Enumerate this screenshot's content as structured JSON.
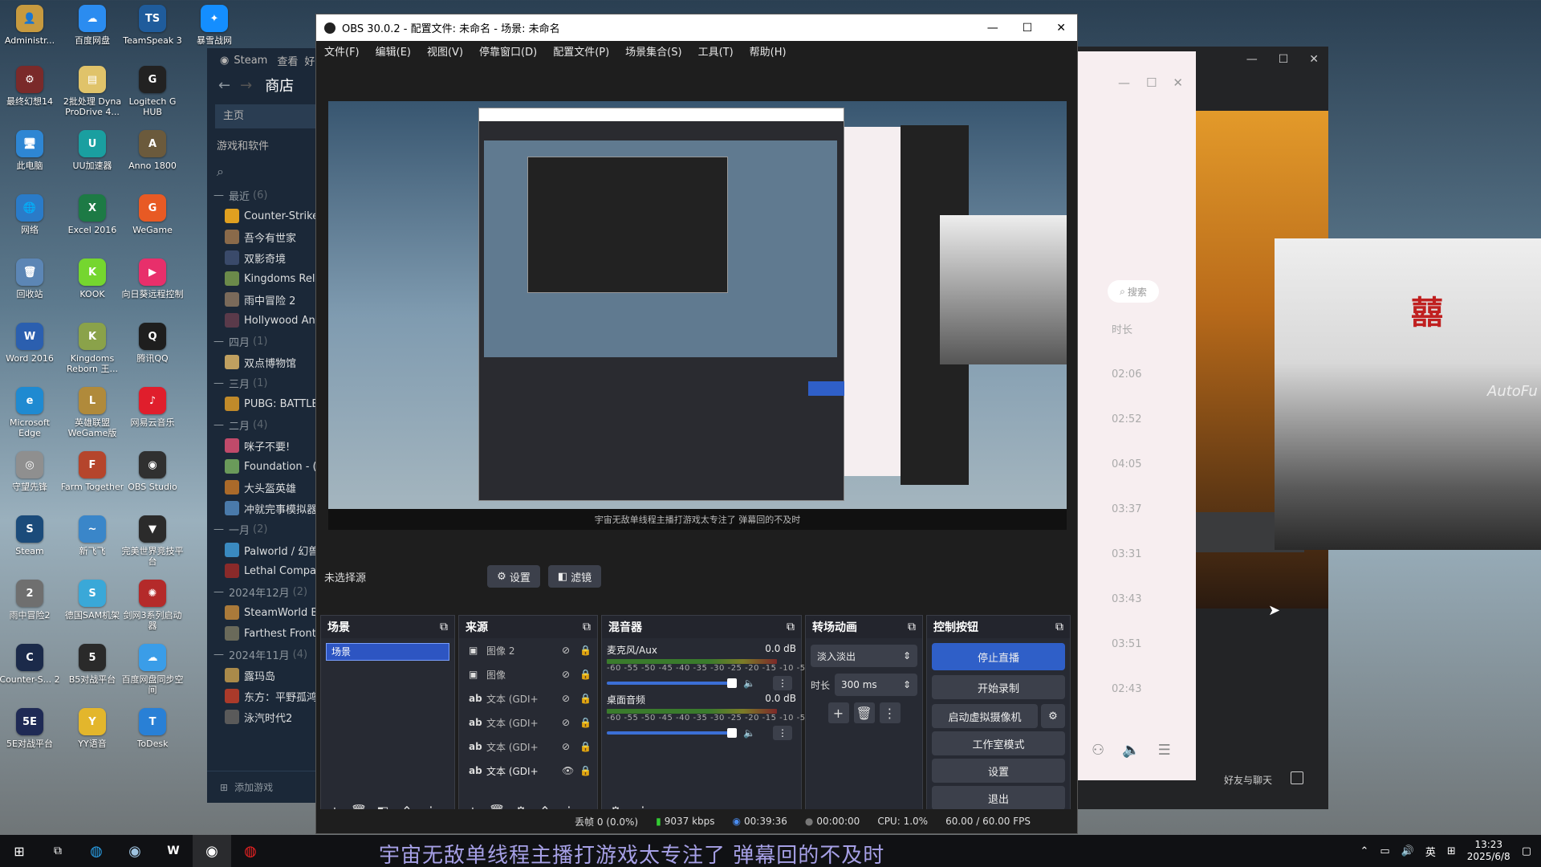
{
  "desktop": {
    "icons": [
      {
        "label": "Administr...",
        "glyph": "👤",
        "color": "#c79a3f",
        "col": 0,
        "row": 0
      },
      {
        "label": "百度网盘",
        "glyph": "☁",
        "color": "#2b8cf0",
        "col": 1,
        "row": 0
      },
      {
        "label": "TeamSpeak 3",
        "glyph": "TS",
        "color": "#1f5c9c",
        "col": 2,
        "row": 0
      },
      {
        "label": "暴雪战网",
        "glyph": "✦",
        "color": "#148eff",
        "col": 3,
        "row": 0
      },
      {
        "label": "最终幻想14",
        "glyph": "⚙",
        "color": "#7a2a2a",
        "col": 0,
        "row": 1
      },
      {
        "label": "2批处理 Dyna ProDrive 4...",
        "glyph": "▤",
        "color": "#e0c36a",
        "col": 1,
        "row": 1
      },
      {
        "label": "Logitech G HUB",
        "glyph": "G",
        "color": "#222",
        "col": 2,
        "row": 1
      },
      {
        "label": "此电脑",
        "glyph": "🖥",
        "color": "#2e86d3",
        "col": 0,
        "row": 2
      },
      {
        "label": "UU加速器",
        "glyph": "U",
        "color": "#1a9fa0",
        "col": 1,
        "row": 2
      },
      {
        "label": "Anno 1800",
        "glyph": "A",
        "color": "#6b5a3c",
        "col": 2,
        "row": 2
      },
      {
        "label": "网络",
        "glyph": "🌐",
        "color": "#2a7bc8",
        "col": 0,
        "row": 3
      },
      {
        "label": "Excel 2016",
        "glyph": "X",
        "color": "#1d7a45",
        "col": 1,
        "row": 3
      },
      {
        "label": "WeGame",
        "glyph": "G",
        "color": "#e85a24",
        "col": 2,
        "row": 3
      },
      {
        "label": "回收站",
        "glyph": "🗑",
        "color": "#5c86b5",
        "col": 0,
        "row": 4
      },
      {
        "label": "KOOK",
        "glyph": "K",
        "color": "#75d62f",
        "col": 1,
        "row": 4
      },
      {
        "label": "向日葵远程控制",
        "glyph": "▶",
        "color": "#e82f6b",
        "col": 2,
        "row": 4
      },
      {
        "label": "Word 2016",
        "glyph": "W",
        "color": "#2b5faf",
        "col": 0,
        "row": 5
      },
      {
        "label": "Kingdoms Reborn 王...",
        "glyph": "K",
        "color": "#8aa24a",
        "col": 1,
        "row": 5
      },
      {
        "label": "腾讯QQ",
        "glyph": "Q",
        "color": "#1e1e1e",
        "col": 2,
        "row": 5
      },
      {
        "label": "Microsoft Edge",
        "glyph": "e",
        "color": "#1f8ad1",
        "col": 0,
        "row": 6
      },
      {
        "label": "英雄联盟WeGame版",
        "glyph": "L",
        "color": "#b08a3b",
        "col": 1,
        "row": 6
      },
      {
        "label": "网易云音乐",
        "glyph": "♪",
        "color": "#e01e2c",
        "col": 2,
        "row": 6
      },
      {
        "label": "守望先锋",
        "glyph": "◎",
        "color": "#8f8f8f",
        "col": 0,
        "row": 7
      },
      {
        "label": "Farm Together",
        "glyph": "F",
        "color": "#b5452c",
        "col": 1,
        "row": 7
      },
      {
        "label": "OBS Studio",
        "glyph": "◉",
        "color": "#303030",
        "col": 2,
        "row": 7
      },
      {
        "label": "Steam",
        "glyph": "S",
        "color": "#1b4b7a",
        "col": 0,
        "row": 8
      },
      {
        "label": "新飞飞",
        "glyph": "~",
        "color": "#3a86c9",
        "col": 1,
        "row": 8
      },
      {
        "label": "完美世界竞技平台",
        "glyph": "▼",
        "color": "#2b2b2b",
        "col": 2,
        "row": 8
      },
      {
        "label": "雨中冒险2",
        "glyph": "2",
        "color": "#6f6f6f",
        "col": 0,
        "row": 9
      },
      {
        "label": "德国SAM机架",
        "glyph": "S",
        "color": "#3aa8d8",
        "col": 1,
        "row": 9
      },
      {
        "label": "剑网3系列启动器",
        "glyph": "✺",
        "color": "#b42a2a",
        "col": 2,
        "row": 9
      },
      {
        "label": "Counter-S... 2",
        "glyph": "C",
        "color": "#1b2a4a",
        "col": 0,
        "row": 10
      },
      {
        "label": "B5对战平台",
        "glyph": "5",
        "color": "#2a2a2a",
        "col": 1,
        "row": 10
      },
      {
        "label": "百度网盘同步空间",
        "glyph": "☁",
        "color": "#3a9de8",
        "col": 2,
        "row": 10
      },
      {
        "label": "5E对战平台",
        "glyph": "5E",
        "color": "#1f2a55",
        "col": 0,
        "row": 11
      },
      {
        "label": "YY语音",
        "glyph": "Y",
        "color": "#e3b62c",
        "col": 1,
        "row": 11
      },
      {
        "label": "ToDesk",
        "glyph": "T",
        "color": "#2980d6",
        "col": 2,
        "row": 11
      }
    ]
  },
  "steam": {
    "brand": "Steam",
    "menu_view": "查看",
    "menu_friends": "好",
    "page": "商店",
    "home": "主页",
    "section": "游戏和软件",
    "groups": [
      {
        "header": "最近",
        "count": "(6)",
        "items": [
          {
            "name": "Counter-Strike",
            "color": "#e0a020"
          },
          {
            "name": "吾今有世家",
            "color": "#8a6a4a"
          },
          {
            "name": "双影奇境",
            "color": "#3a4a6a"
          },
          {
            "name": "Kingdoms Rel",
            "color": "#6b8a4a"
          },
          {
            "name": "雨中冒险 2",
            "color": "#7a6a5a"
          },
          {
            "name": "Hollywood An",
            "color": "#5a3a4a"
          }
        ]
      },
      {
        "header": "四月",
        "count": "(1)",
        "items": [
          {
            "name": "双点博物馆",
            "color": "#c0a060"
          }
        ]
      },
      {
        "header": "三月",
        "count": "(1)",
        "items": [
          {
            "name": "PUBG: BATTLE",
            "color": "#c08a2a"
          }
        ]
      },
      {
        "header": "二月",
        "count": "(4)",
        "items": [
          {
            "name": "咪子不要!",
            "color": "#c04a6a"
          },
          {
            "name": "Foundation - (",
            "color": "#6a9a5a"
          },
          {
            "name": "大头盔英雄",
            "color": "#aa6a2a"
          },
          {
            "name": "冲就完事模拟器",
            "color": "#4a7aaa"
          }
        ]
      },
      {
        "header": "一月",
        "count": "(2)",
        "items": [
          {
            "name": "Palworld / 幻兽",
            "color": "#3a8ac0"
          },
          {
            "name": "Lethal Compar",
            "color": "#8a2a2a"
          }
        ]
      },
      {
        "header": "2024年12月",
        "count": "(2)",
        "items": [
          {
            "name": "SteamWorld B",
            "color": "#aa7a3a"
          },
          {
            "name": "Farthest Front",
            "color": "#6a6a5a"
          }
        ]
      },
      {
        "header": "2024年11月",
        "count": "(4)",
        "items": [
          {
            "name": "露玛岛",
            "color": "#aa8a4a"
          },
          {
            "name": "东方：平野孤鸿",
            "color": "#aa3a2a"
          },
          {
            "name": "泳汽时代2",
            "color": "#5a5a5a"
          }
        ]
      }
    ],
    "add_game": "添加游戏"
  },
  "right_window": {
    "search": "搜索",
    "column": "时长",
    "times": [
      "02:06",
      "02:52",
      "04:05",
      "03:37",
      "03:31",
      "03:43",
      "03:51",
      "02:43"
    ],
    "footer": "好友与聊天"
  },
  "obs": {
    "title": "OBS 30.0.2 - 配置文件: 未命名 - 场景: 未命名",
    "menus": [
      "文件(F)",
      "编辑(E)",
      "视图(V)",
      "停靠窗口(D)",
      "配置文件(P)",
      "场景集合(S)",
      "工具(T)",
      "帮助(H)"
    ],
    "no_source": "未选择源",
    "settings_tab": "设置",
    "filters_tab": "滤镜",
    "scenes": {
      "title": "场景",
      "items": [
        "场景"
      ]
    },
    "sources": {
      "title": "来源",
      "items": [
        {
          "type": "img",
          "name": "图像 2",
          "visible": false
        },
        {
          "type": "img",
          "name": "图像",
          "visible": false
        },
        {
          "type": "txt",
          "name": "文本 (GDI+",
          "visible": false
        },
        {
          "type": "txt",
          "name": "文本 (GDI+",
          "visible": false
        },
        {
          "type": "txt",
          "name": "文本 (GDI+",
          "visible": false
        },
        {
          "type": "txt",
          "name": "文本 (GDI+",
          "visible": true
        }
      ]
    },
    "mixer": {
      "title": "混音器",
      "scale": "-60 -55 -50 -45 -40 -35 -30 -25 -20 -15 -10 -5 0",
      "channels": [
        {
          "name": "麦克风/Aux",
          "db": "0.0 dB",
          "level": 0.9
        },
        {
          "name": "桌面音频",
          "db": "0.0 dB",
          "level": 0.9
        }
      ]
    },
    "transitions": {
      "title": "转场动画",
      "selected": "淡入淡出",
      "duration_label": "时长",
      "duration": "300 ms"
    },
    "controls": {
      "title": "控制按钮",
      "stop_stream": "停止直播",
      "start_record": "开始录制",
      "virtual_cam": "启动虚拟摄像机",
      "studio_mode": "工作室模式",
      "settings": "设置",
      "exit": "退出"
    },
    "status": {
      "dropped": "丢帧 0 (0.0%)",
      "bitrate": "9037 kbps",
      "stream_time": "00:39:36",
      "record_time": "00:00:00",
      "cpu": "CPU: 1.0%",
      "fps": "60.00 / 60.00 FPS"
    },
    "preview_caption": "宇宙无敌单线程主播打游戏太专注了 弹幕回的不及时"
  },
  "subtitle": "宇宙无敌单线程主播打游戏太专注了 弹幕回的不及时",
  "taskbar": {
    "ime": "英",
    "time": "13:23",
    "date": "2025/6/8"
  }
}
